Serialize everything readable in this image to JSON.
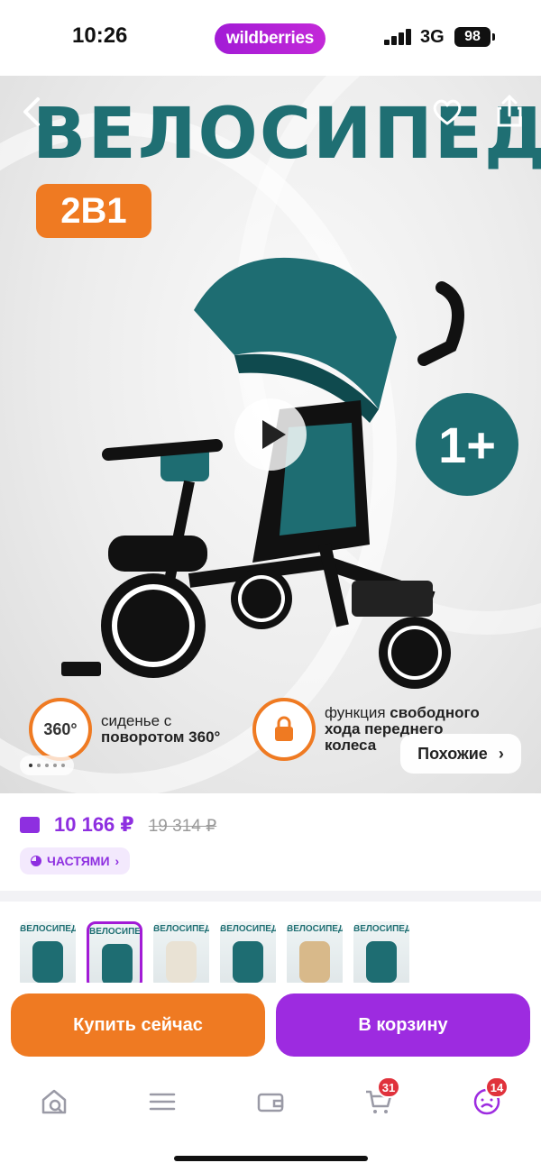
{
  "status_bar": {
    "time": "10:26",
    "brand": "wildberries",
    "network": "3G",
    "battery": "98"
  },
  "gallery": {
    "headline": "ВЕЛОСИПЕД",
    "badge_2in1": "2В1",
    "age_badge": "1+",
    "features": [
      {
        "icon_text": "360°",
        "line1": "сиденье с",
        "line2_bold": "поворотом 360°"
      },
      {
        "icon_text": "",
        "line1": "функция",
        "line1_bold": "свободного",
        "line2_bold": "хода переднего",
        "line3_bold": "колеса"
      }
    ],
    "similar_label": "Похожие",
    "page_dots": 5,
    "active_dot": 0,
    "icons": [
      "back-arrow-icon",
      "heart-icon",
      "share-icon",
      "play-icon"
    ]
  },
  "price": {
    "current": "10 166 ₽",
    "old": "19 314 ₽",
    "installments_label": "ЧАСТЯМИ"
  },
  "thumbnails": [
    {
      "title": "ВЕЛОСИПЕД",
      "active": false
    },
    {
      "title": "ВЕЛОСИПЕД",
      "active": true
    },
    {
      "title": "ВЕЛОСИПЕД",
      "active": false
    },
    {
      "title": "ВЕЛОСИПЕД",
      "active": false
    },
    {
      "title": "ВЕЛОСИПЕД",
      "active": false
    },
    {
      "title": "ВЕЛОСИПЕД",
      "active": false
    }
  ],
  "actions": {
    "buy_now": "Купить сейчас",
    "add_to_cart": "В корзину"
  },
  "tabbar": {
    "items": [
      {
        "icon": "home-search-icon"
      },
      {
        "icon": "menu-icon"
      },
      {
        "icon": "wallet-icon"
      },
      {
        "icon": "cart-icon",
        "badge": "31"
      },
      {
        "icon": "profile-icon",
        "badge": "14"
      }
    ]
  },
  "colors": {
    "brand_purple": "#9d2be0",
    "accent_orange": "#ef7a22",
    "teal": "#1e6d72"
  }
}
